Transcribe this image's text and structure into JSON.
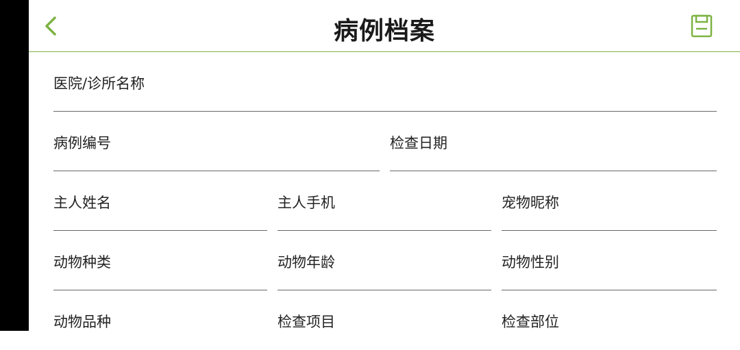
{
  "header": {
    "title": "病例档案"
  },
  "icons": {
    "back": "chevron-left-icon",
    "save": "save-icon"
  },
  "colors": {
    "accent": "#7cb342"
  },
  "form": {
    "hospital_name_label": "医院/诊所名称",
    "case_number_label": "病例编号",
    "exam_date_label": "检查日期",
    "owner_name_label": "主人姓名",
    "owner_phone_label": "主人手机",
    "pet_nickname_label": "宠物昵称",
    "animal_type_label": "动物种类",
    "animal_age_label": "动物年龄",
    "animal_sex_label": "动物性别",
    "animal_breed_label": "动物品种",
    "exam_item_label": "检查项目",
    "exam_area_label": "检查部位"
  }
}
